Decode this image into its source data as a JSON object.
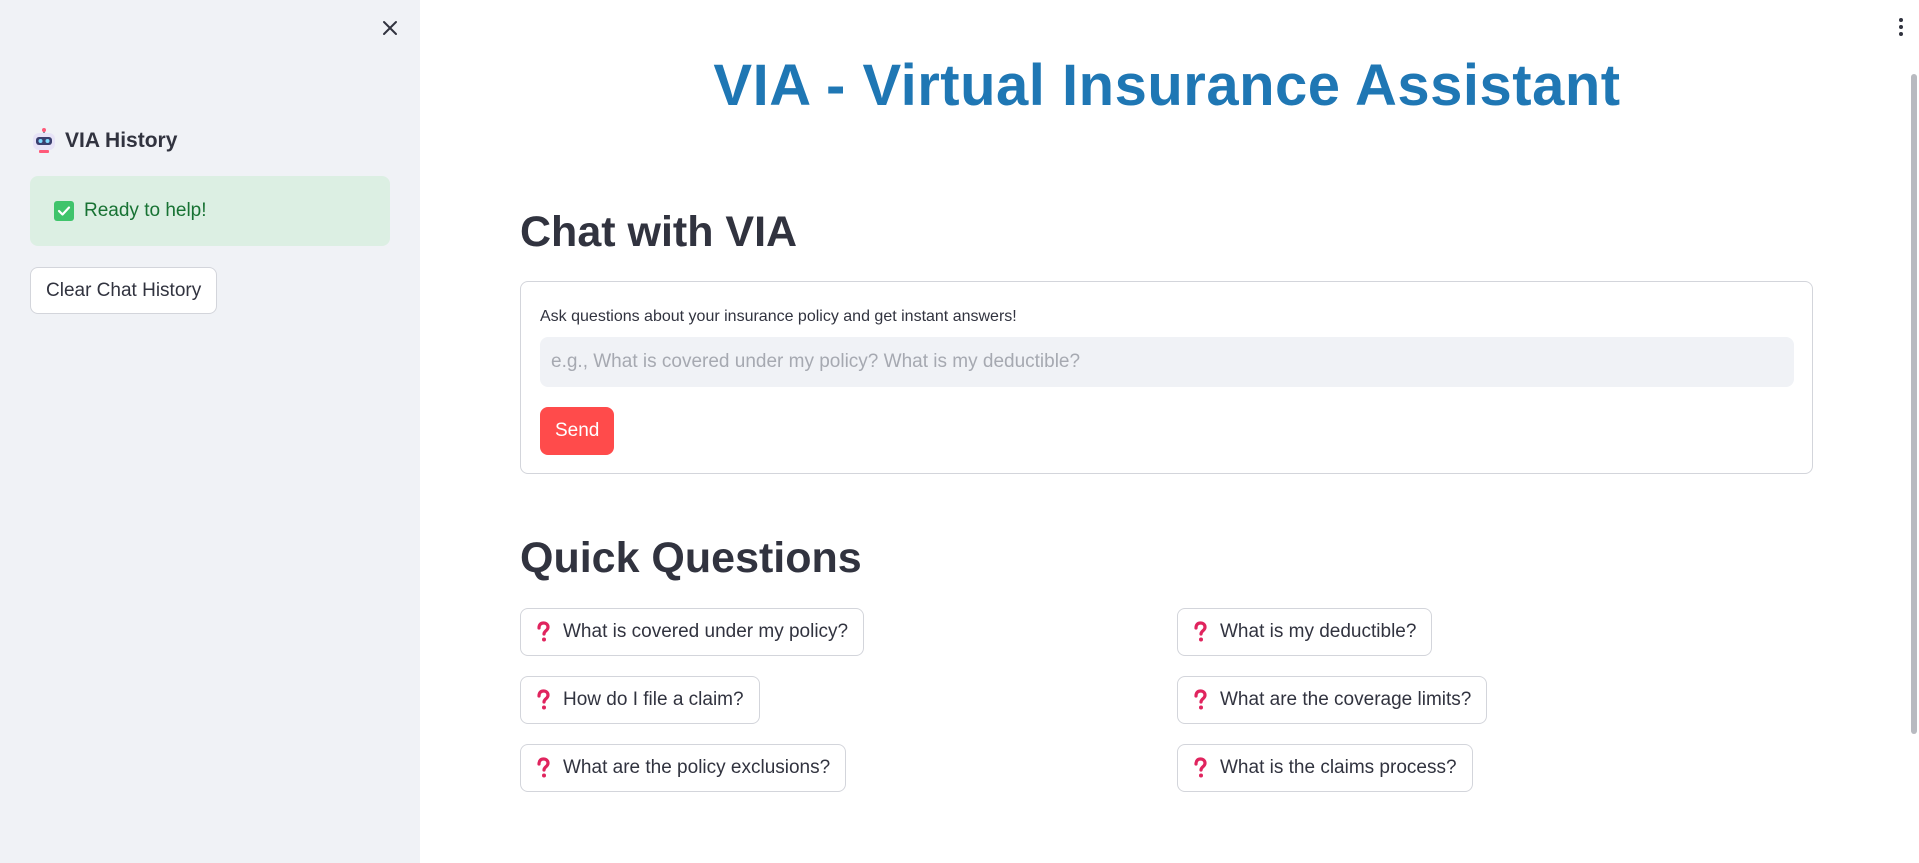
{
  "sidebar": {
    "title": "VIA History",
    "status": "Ready to help!",
    "clear_button": "Clear Chat History"
  },
  "main": {
    "app_title": "VIA - Virtual Insurance Assistant",
    "chat": {
      "heading": "Chat with VIA",
      "label": "Ask questions about your insurance policy and get instant answers!",
      "placeholder": "e.g., What is covered under my policy? What is my deductible?",
      "value": "",
      "send_button": "Send"
    },
    "quick_questions": {
      "heading": "Quick Questions",
      "items": [
        "What is covered under my policy?",
        "What is my deductible?",
        "How do I file a claim?",
        "What are the coverage limits?",
        "What are the policy exclusions?",
        "What is the claims process?"
      ]
    }
  },
  "colors": {
    "title_blue": "#1f77b4",
    "send_red": "#ff4b4b",
    "success_bg": "#dcefe3",
    "success_text": "#177233",
    "sidebar_bg": "#f0f2f6"
  },
  "icons": {
    "sidebar_close": "close-icon",
    "sidebar_title": "robot-icon",
    "status": "check-icon",
    "quick_question": "question-mark-icon",
    "main_menu": "more-vertical-icon"
  }
}
